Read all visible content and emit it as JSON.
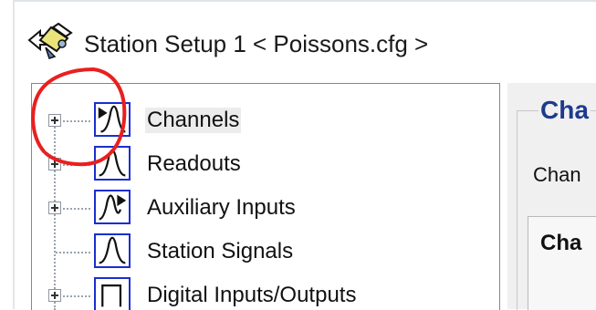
{
  "window": {
    "title": "Station Setup 1 < Poissons.cfg >",
    "icon": "station-setup-icon"
  },
  "tree": {
    "items": [
      {
        "label": "Channels",
        "icon": "signal-wave-icon",
        "expandable": true,
        "selected": true
      },
      {
        "label": "Readouts",
        "icon": "signal-wave-icon",
        "expandable": true,
        "selected": false
      },
      {
        "label": "Auxiliary Inputs",
        "icon": "signal-wave-icon",
        "expandable": true,
        "selected": false
      },
      {
        "label": "Station Signals",
        "icon": "signal-wave-icon",
        "expandable": false,
        "selected": false
      },
      {
        "label": "Digital Inputs/Outputs",
        "icon": "digital-signal-icon",
        "expandable": true,
        "selected": false
      }
    ]
  },
  "right_panel": {
    "group_title": "Cha",
    "group_description": "Chan",
    "tab_label": "Cha"
  },
  "annotation": {
    "color": "#e8201f",
    "shape": "hand-drawn circle around Channels expander"
  },
  "colors": {
    "icon_border": "#1a2ecf",
    "group_title": "#1d3b8c",
    "selection": "#ececec"
  }
}
